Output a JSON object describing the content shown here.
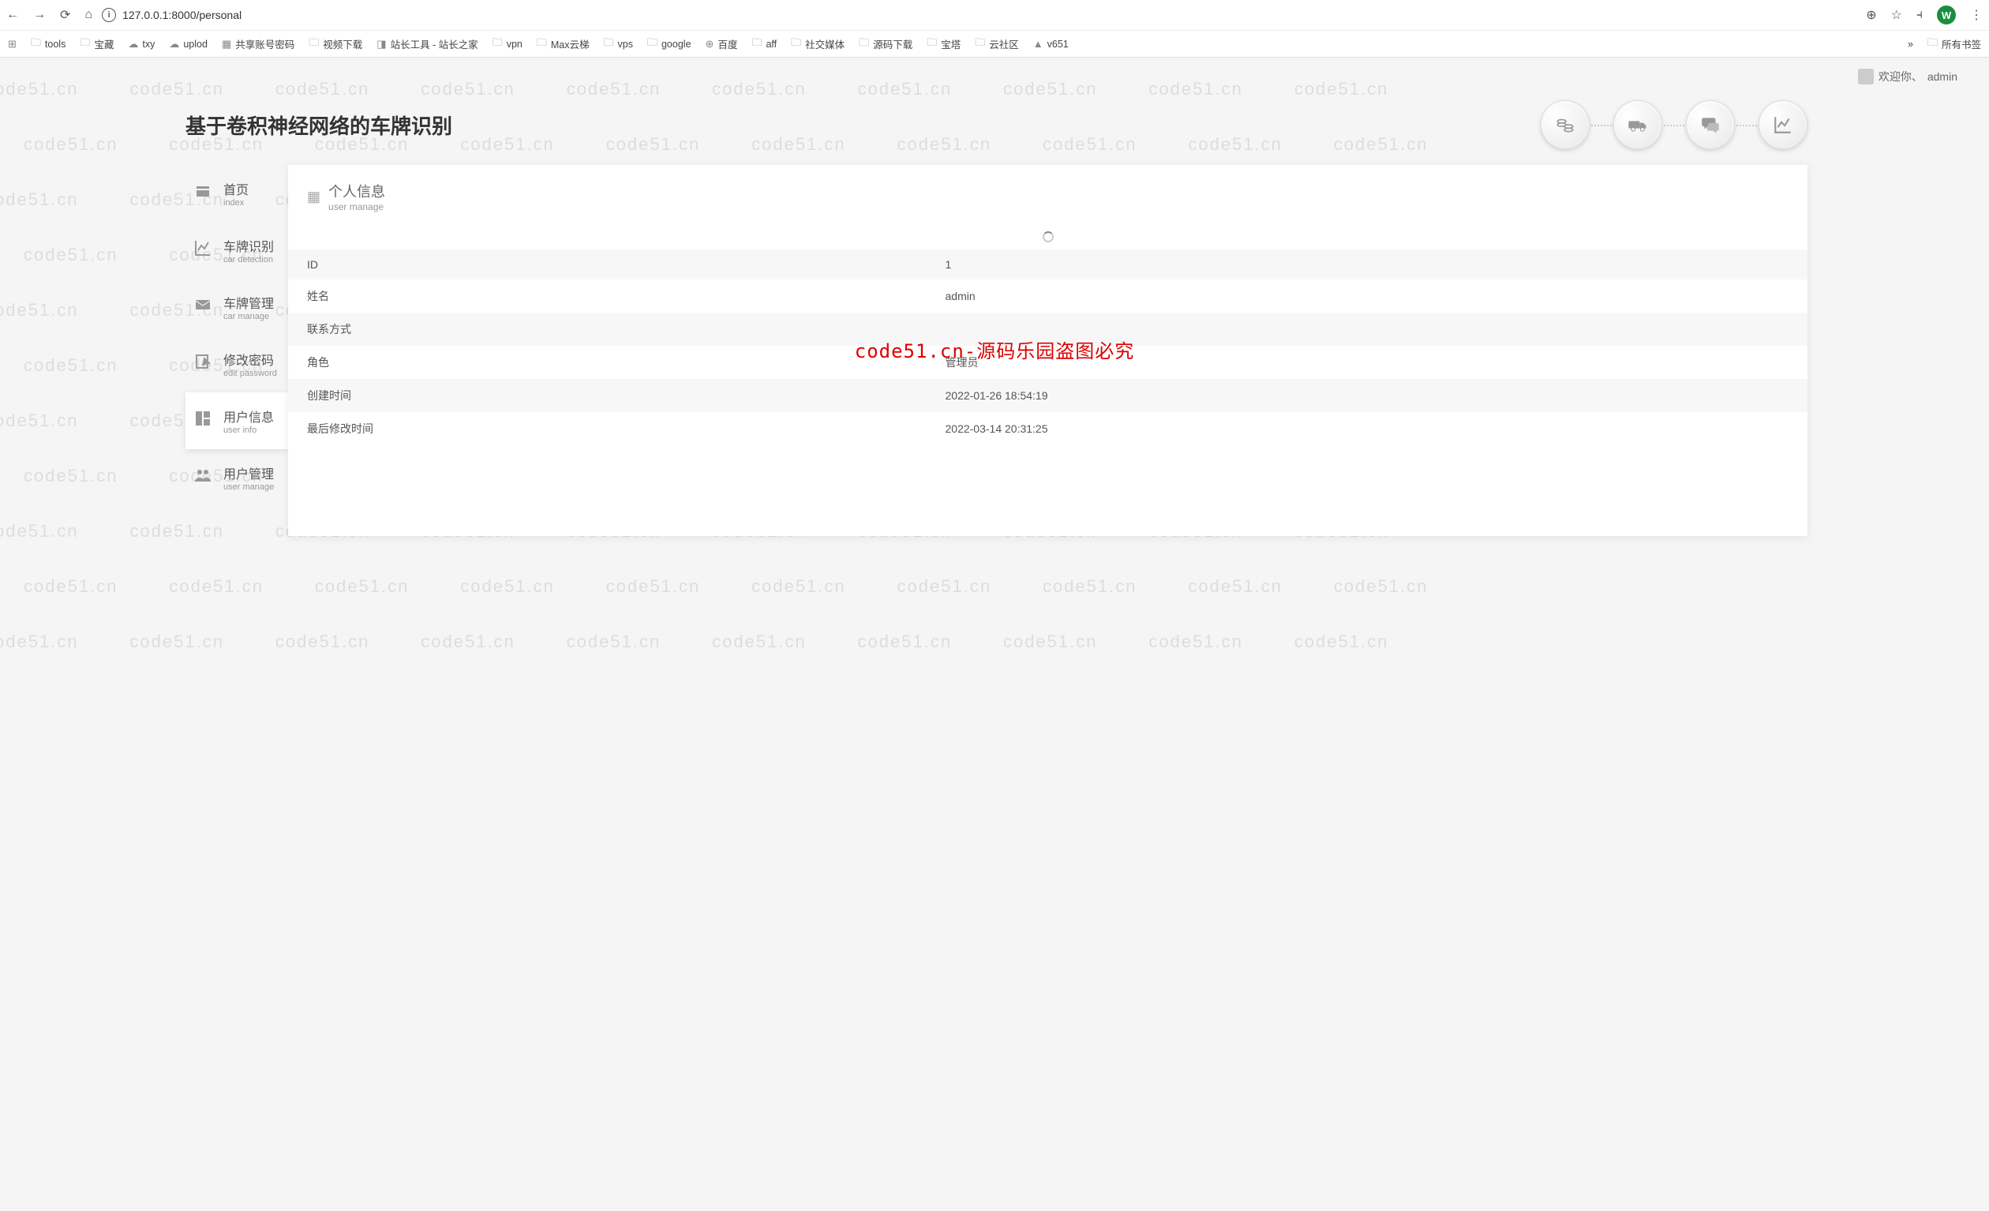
{
  "browser": {
    "url": "127.0.0.1:8000/personal",
    "profile_letter": "W",
    "all_bookmarks": "所有书签",
    "bookmarks": [
      {
        "icon": "⊞",
        "label": ""
      },
      {
        "icon": "📁",
        "label": "tools"
      },
      {
        "icon": "📁",
        "label": "宝藏"
      },
      {
        "icon": "☁",
        "label": "txy"
      },
      {
        "icon": "☁",
        "label": "uplod"
      },
      {
        "icon": "▦",
        "label": "共享账号密码"
      },
      {
        "icon": "📁",
        "label": "视频下载"
      },
      {
        "icon": "◨",
        "label": "站长工具 - 站长之家"
      },
      {
        "icon": "📁",
        "label": "vpn"
      },
      {
        "icon": "📁",
        "label": "Max云梯"
      },
      {
        "icon": "📁",
        "label": "vps"
      },
      {
        "icon": "📁",
        "label": "google"
      },
      {
        "icon": "⊕",
        "label": "百度"
      },
      {
        "icon": "📁",
        "label": "aff"
      },
      {
        "icon": "📁",
        "label": "社交媒体"
      },
      {
        "icon": "📁",
        "label": "源码下载"
      },
      {
        "icon": "📁",
        "label": "宝塔"
      },
      {
        "icon": "📁",
        "label": "云社区"
      },
      {
        "icon": "▲",
        "label": "v651"
      }
    ]
  },
  "header": {
    "welcome": "欢迎你、",
    "username": "admin",
    "title": "基于卷积神经网络的车牌识别"
  },
  "circle_icons": [
    "coins",
    "truck",
    "chat",
    "chart"
  ],
  "sidebar": [
    {
      "zh": "首页",
      "en": "index",
      "icon": "home"
    },
    {
      "zh": "车牌识别",
      "en": "car detection",
      "icon": "chart"
    },
    {
      "zh": "车牌管理",
      "en": "car manage",
      "icon": "mail"
    },
    {
      "zh": "修改密码",
      "en": "edit password",
      "icon": "edit"
    },
    {
      "zh": "用户信息",
      "en": "user info",
      "icon": "grid",
      "active": true
    },
    {
      "zh": "用户管理",
      "en": "user manage",
      "icon": "users"
    }
  ],
  "panel": {
    "title_zh": "个人信息",
    "title_en": "user manage",
    "rows": [
      {
        "label": "ID",
        "value": "1"
      },
      {
        "label": "姓名",
        "value": "admin"
      },
      {
        "label": "联系方式",
        "value": ""
      },
      {
        "label": "角色",
        "value": "管理员"
      },
      {
        "label": "创建时间",
        "value": "2022-01-26 18:54:19"
      },
      {
        "label": "最后修改时间",
        "value": "2022-03-14 20:31:25"
      }
    ]
  },
  "watermark_text": "code51.cn",
  "red_overlay": "code51.cn-源码乐园盗图必究"
}
